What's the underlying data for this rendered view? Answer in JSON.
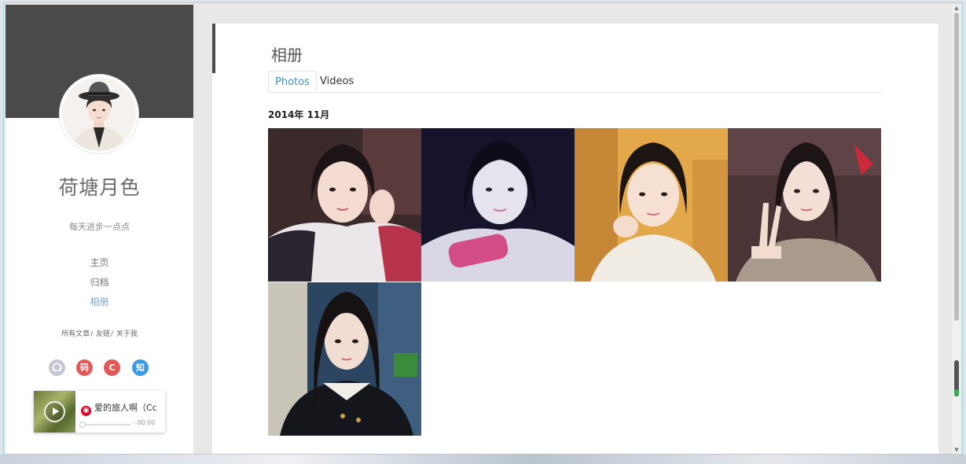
{
  "sidebar": {
    "blog_title": "荷塘月色",
    "subtitle": "每天进步一点点",
    "nav": [
      "主页",
      "归档",
      "相册"
    ],
    "active_nav": "相册",
    "links": [
      "所有文章",
      "友链",
      "关于我"
    ],
    "social": [
      {
        "icon": "github-icon",
        "label": "",
        "color": "#c3c7d2"
      },
      {
        "icon": "coding-icon",
        "label": "码",
        "color": "#e05a5a"
      },
      {
        "icon": "csdn-icon",
        "label": "C",
        "color": "#e05a5a"
      },
      {
        "icon": "zhihu-icon",
        "label": "知",
        "color": "#3c9be0"
      }
    ],
    "player": {
      "song": "爱的旅人啊（Cc",
      "time": "- 00:00",
      "service_icon": "netease-music-icon"
    }
  },
  "main": {
    "page_title": "相册",
    "tabs": [
      "Photos",
      "Videos"
    ],
    "active_tab": "Photos",
    "month_heading": "2014年  11月",
    "photos": [
      {
        "name": "photo-1"
      },
      {
        "name": "photo-2"
      },
      {
        "name": "photo-3"
      },
      {
        "name": "photo-4"
      },
      {
        "name": "photo-5"
      }
    ]
  },
  "colors": {
    "sidebar_header": "#4a4a4a",
    "accent": "#3a8fd6",
    "active_nav": "#7aa7c7"
  }
}
